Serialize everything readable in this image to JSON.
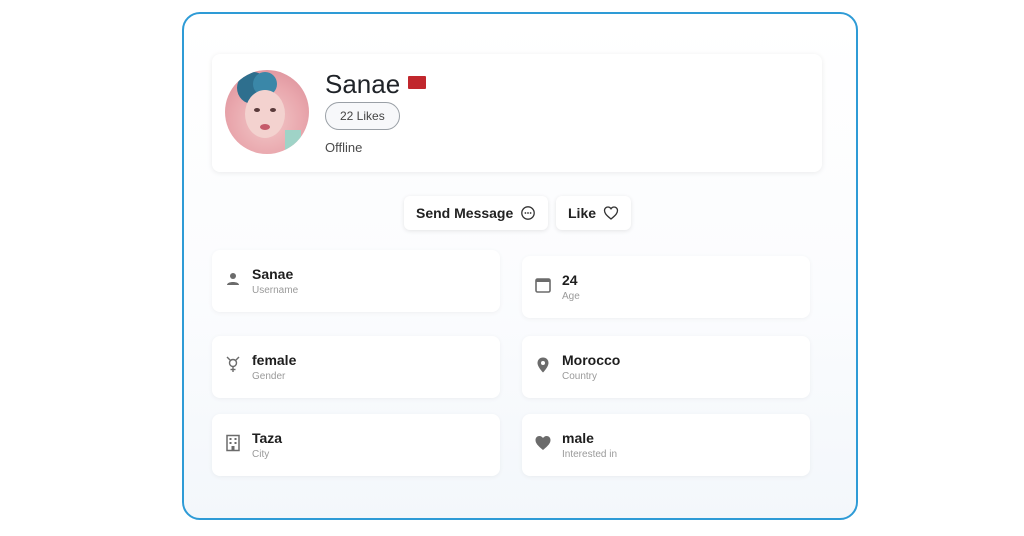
{
  "profile": {
    "name": "Sanae",
    "likes": "22 Likes",
    "status": "Offline",
    "flag_color": "#c1272d"
  },
  "actions": {
    "send_message": "Send Message",
    "like": "Like"
  },
  "details": {
    "username": {
      "value": "Sanae",
      "label": "Username",
      "icon": "person-icon"
    },
    "age": {
      "value": "24",
      "label": "Age",
      "icon": "calendar-icon"
    },
    "gender": {
      "value": "female",
      "label": "Gender",
      "icon": "gender-icon"
    },
    "country": {
      "value": "Morocco",
      "label": "Country",
      "icon": "location-pin-icon"
    },
    "city": {
      "value": "Taza",
      "label": "City",
      "icon": "building-icon"
    },
    "interested_in": {
      "value": "male",
      "label": "Interested in",
      "icon": "heart-icon"
    }
  },
  "colors": {
    "frame_border": "#2e9bd6"
  }
}
